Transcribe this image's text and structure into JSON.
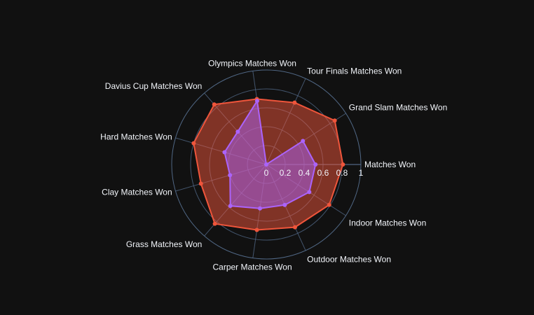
{
  "chart_data": {
    "type": "radar",
    "theta": [
      "Matches Won",
      "Grand Slam Matches Won",
      "Tour Finals Matches Won",
      "Olympics Matches Won",
      "Davius Cup Matches Won",
      "Hard Matches Won",
      "Clay Matches Won",
      "Grass Matches Won",
      "Carper Matches Won",
      "Outdoor Matches Won",
      "Indoor Matches Won"
    ],
    "radial_ticks": [
      "0",
      "0.2",
      "0.4",
      "0.6",
      "0.8",
      "1"
    ],
    "rlim": [
      0,
      1
    ],
    "series": [
      {
        "color": "#EF553B",
        "values": [
          0.81,
          0.86,
          0.72,
          0.7,
          0.84,
          0.8,
          0.72,
          0.83,
          0.7,
          0.73,
          0.79
        ]
      },
      {
        "color": "#AB63FA",
        "values": [
          0.52,
          0.46,
          0.0,
          0.68,
          0.46,
          0.46,
          0.4,
          0.58,
          0.47,
          0.47,
          0.54
        ]
      }
    ],
    "colors": {
      "background": "#111111",
      "grid": "#506784",
      "text": "#f2f5fa"
    }
  }
}
